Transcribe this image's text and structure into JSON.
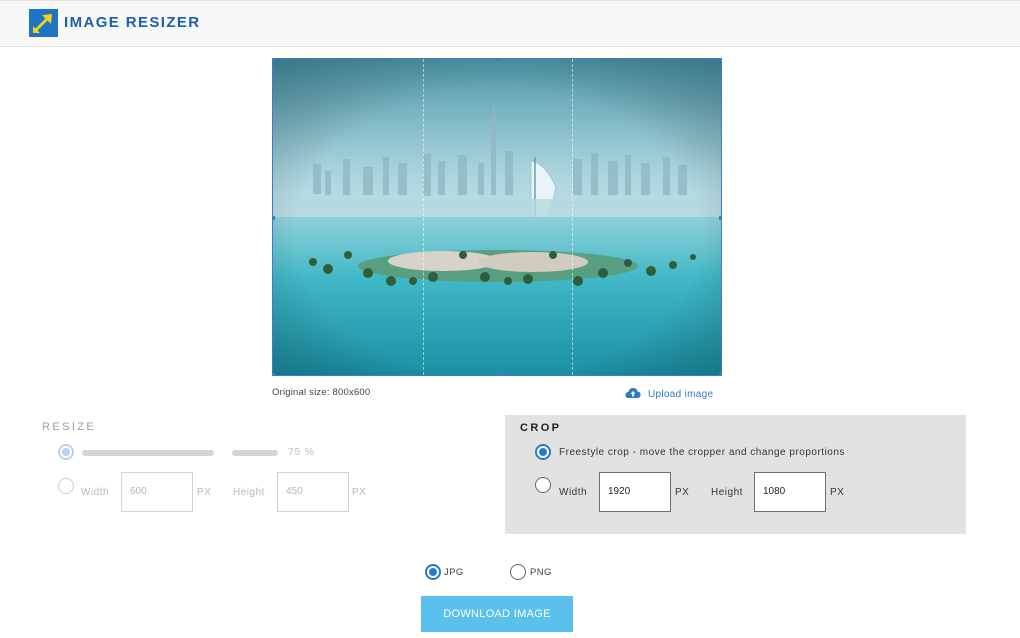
{
  "app": {
    "title": "IMAGE RESIZER",
    "icon": "resize-arrow-icon",
    "accent": "#1f73c4"
  },
  "preview": {
    "original_size": "Original size: 800x600",
    "upload_label": "Upload image",
    "upload_icon": "cloud-upload-icon"
  },
  "resize": {
    "title": "RESIZE",
    "percent_label": "75 %",
    "percent_value": 75,
    "width_label": "Width",
    "width_value": "600",
    "height_label": "Height",
    "height_value": "450",
    "unit": "PX",
    "enabled": false
  },
  "crop": {
    "title": "CROP",
    "freestyle_label": "Freestyle crop - move the cropper and change proportions",
    "freestyle_selected": true,
    "width_label": "Width",
    "width_value": "1920",
    "height_label": "Height",
    "height_value": "1080",
    "unit": "PX"
  },
  "format": {
    "options": [
      "JPG",
      "PNG"
    ],
    "selected": "JPG"
  },
  "download": {
    "label": "DOWNLOAD IMAGE",
    "color": "#5bc0eb"
  }
}
